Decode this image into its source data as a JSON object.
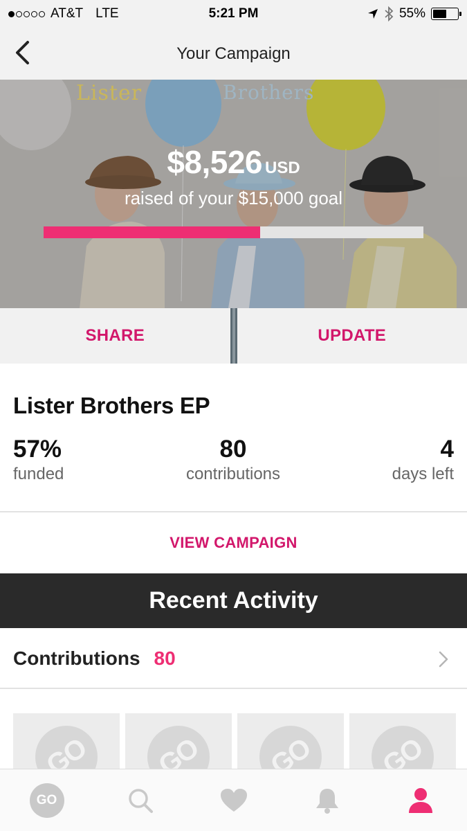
{
  "status_bar": {
    "carrier": "AT&T",
    "network": "LTE",
    "time": "5:21 PM",
    "battery": "55%",
    "battery_level": 0.55,
    "signal_bars": 1
  },
  "nav": {
    "title": "Your Campaign",
    "back_icon": "chevron-left-icon"
  },
  "hero": {
    "brand_left": "Lister",
    "brand_right": "Brothers",
    "amount": "$8,526",
    "currency": "USD",
    "subtitle": "raised of your $15,000 goal",
    "progress": 0.57
  },
  "actions": {
    "share_label": "SHARE",
    "update_label": "UPDATE"
  },
  "campaign": {
    "title": "Lister Brothers EP",
    "stats": {
      "funded_value": "57%",
      "funded_label": "funded",
      "contributions_value": "80",
      "contributions_label": "contributions",
      "days_value": "4",
      "days_label": "days left"
    },
    "view_label": "VIEW CAMPAIGN"
  },
  "recent": {
    "title": "Recent Activity",
    "contributions_label": "Contributions",
    "contributions_count": "80",
    "thumb_text": "GO"
  },
  "tab_bar": {
    "items": [
      {
        "name": "home",
        "icon": "go-logo-icon",
        "label": "GO"
      },
      {
        "name": "search",
        "icon": "search-icon"
      },
      {
        "name": "favorites",
        "icon": "heart-icon"
      },
      {
        "name": "notifications",
        "icon": "bell-icon"
      },
      {
        "name": "profile",
        "icon": "person-icon"
      }
    ]
  },
  "colors": {
    "accent": "#ee2e73",
    "accent_text": "#d2176b",
    "header_dark": "#2a2a2a",
    "inactive_icon": "#c9c9c9"
  }
}
